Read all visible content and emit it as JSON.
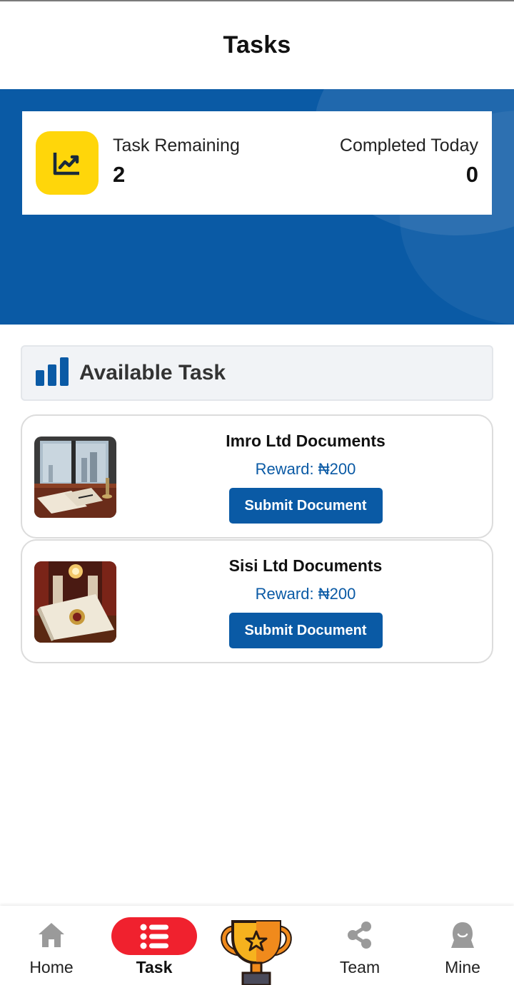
{
  "header": {
    "title": "Tasks"
  },
  "stats": {
    "remaining_label": "Task Remaining",
    "remaining_value": "2",
    "completed_label": "Completed Today",
    "completed_value": "0",
    "icon": "trending-chart-icon"
  },
  "section": {
    "title": "Available Task",
    "icon": "bar-chart-icon"
  },
  "tasks": [
    {
      "title": "Imro Ltd Documents",
      "reward": "Reward: ₦200",
      "button": "Submit Document",
      "image": "office-desk-documents-photo"
    },
    {
      "title": "Sisi Ltd Documents",
      "reward": "Reward: ₦200",
      "button": "Submit Document",
      "image": "embossed-certificate-photo"
    }
  ],
  "nav": {
    "items": [
      {
        "label": "Home",
        "icon": "home-icon"
      },
      {
        "label": "Task",
        "icon": "list-icon",
        "active": true
      },
      {
        "label": "",
        "icon": "trophy-icon"
      },
      {
        "label": "Team",
        "icon": "share-icon"
      },
      {
        "label": "Mine",
        "icon": "user-icon"
      }
    ]
  },
  "colors": {
    "primary": "#0a5aa5",
    "accent_yellow": "#ffd60a",
    "active_red": "#f0212e"
  }
}
